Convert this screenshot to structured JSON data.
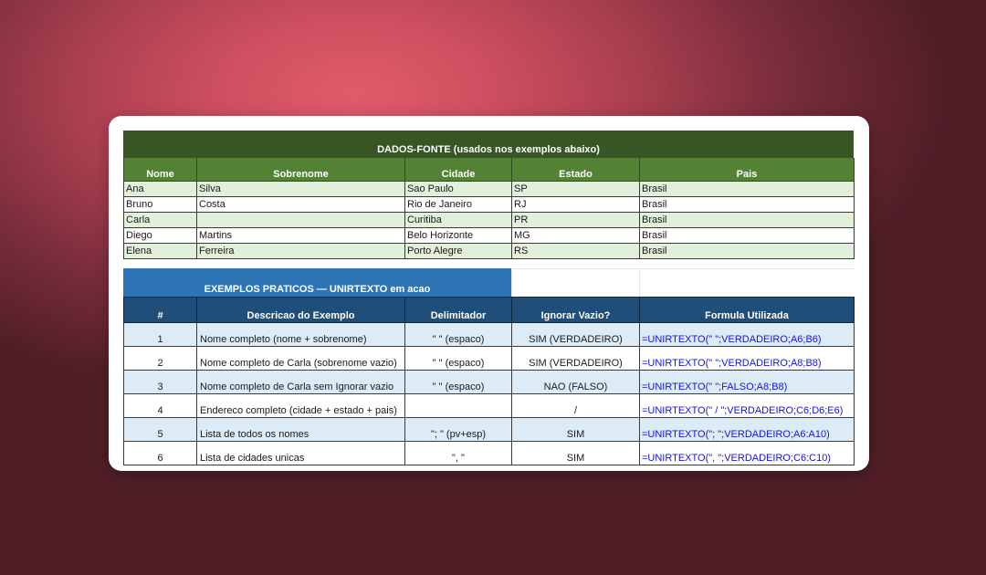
{
  "source": {
    "title": "DADOS-FONTE (usados nos exemplos abaixo)",
    "headers": [
      "Nome",
      "Sobrenome",
      "Cidade",
      "Estado",
      "Pais"
    ],
    "rows": [
      [
        "Ana",
        "Silva",
        "Sao Paulo",
        "SP",
        "Brasil"
      ],
      [
        "Bruno",
        "Costa",
        "Rio de Janeiro",
        "RJ",
        "Brasil"
      ],
      [
        "Carla",
        "",
        "Curitiba",
        "PR",
        "Brasil"
      ],
      [
        "Diego",
        "Martins",
        "Belo Horizonte",
        "MG",
        "Brasil"
      ],
      [
        "Elena",
        "Ferreira",
        "Porto Alegre",
        "RS",
        "Brasil"
      ]
    ]
  },
  "examples": {
    "title": "EXEMPLOS PRATICOS — UNIRTEXTO em acao",
    "headers": [
      "#",
      "Descricao do Exemplo",
      "Delimitador",
      "Ignorar Vazio?",
      "Formula Utilizada"
    ],
    "rows": [
      [
        "1",
        "Nome completo (nome + sobrenome)",
        "\" \" (espaco)",
        "SIM (VERDADEIRO)",
        "=UNIRTEXTO(\" \";VERDADEIRO;A6;B6)"
      ],
      [
        "2",
        "Nome completo de Carla (sobrenome vazio)",
        "\" \" (espaco)",
        "SIM (VERDADEIRO)",
        "=UNIRTEXTO(\" \";VERDADEIRO;A8;B8)"
      ],
      [
        "3",
        "Nome completo de Carla sem Ignorar vazio",
        "\" \" (espaco)",
        "NAO (FALSO)",
        "=UNIRTEXTO(\" \";FALSO;A8;B8)"
      ],
      [
        "4",
        "Endereco completo (cidade + estado + pais)",
        "",
        "/",
        "=UNIRTEXTO(\" / \";VERDADEIRO;C6;D6;E6)"
      ],
      [
        "5",
        "Lista de todos os nomes",
        "\"; \" (pv+esp)",
        "SIM",
        "=UNIRTEXTO(\"; \";VERDADEIRO;A6:A10)"
      ],
      [
        "6",
        "Lista de cidades unicas",
        "\", \"",
        "SIM",
        "=UNIRTEXTO(\", \";VERDADEIRO;C6:C10)"
      ]
    ]
  },
  "colors": {
    "source_title_bg": "#375623",
    "source_header_bg": "#548235",
    "source_band": "#e2efda",
    "examples_title_bg": "#2e75b6",
    "examples_header_bg": "#1f4e79",
    "examples_band": "#ddebf7",
    "formula_text": "#1515d6"
  }
}
